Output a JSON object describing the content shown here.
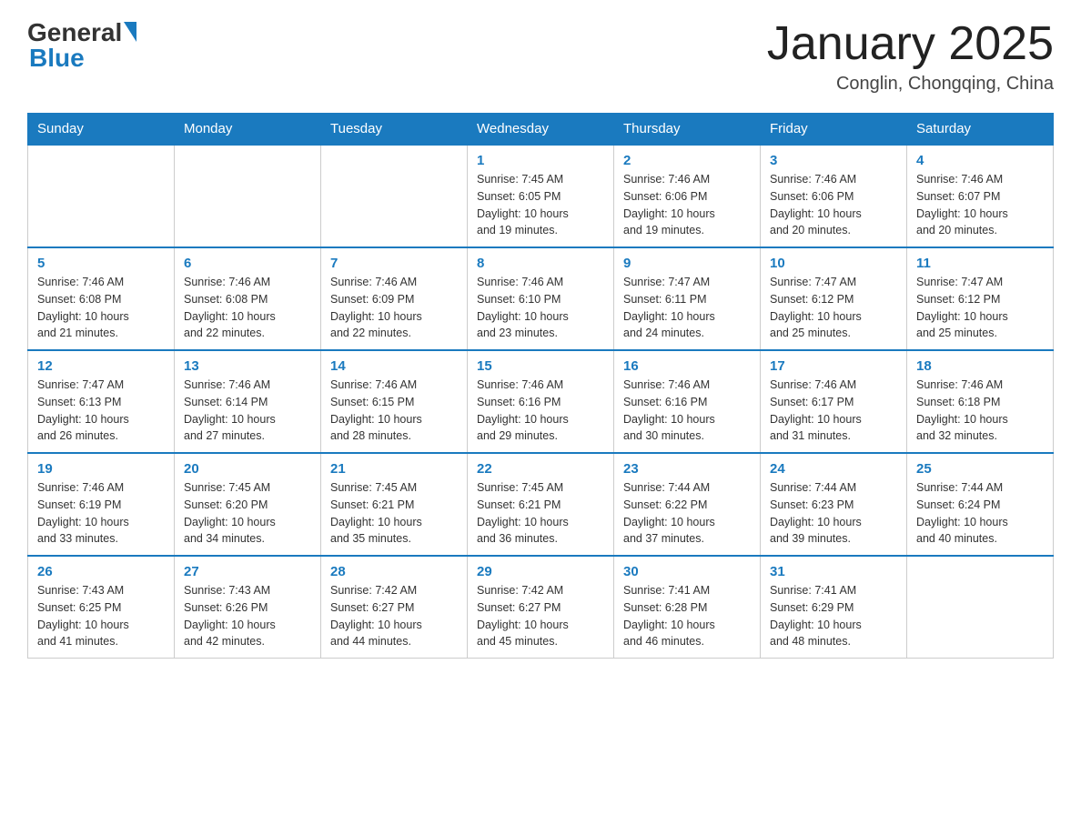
{
  "header": {
    "logo_general": "General",
    "logo_blue": "Blue",
    "month_title": "January 2025",
    "location": "Conglin, Chongqing, China"
  },
  "days_of_week": [
    "Sunday",
    "Monday",
    "Tuesday",
    "Wednesday",
    "Thursday",
    "Friday",
    "Saturday"
  ],
  "weeks": [
    [
      {
        "day": "",
        "info": ""
      },
      {
        "day": "",
        "info": ""
      },
      {
        "day": "",
        "info": ""
      },
      {
        "day": "1",
        "info": "Sunrise: 7:45 AM\nSunset: 6:05 PM\nDaylight: 10 hours\nand 19 minutes."
      },
      {
        "day": "2",
        "info": "Sunrise: 7:46 AM\nSunset: 6:06 PM\nDaylight: 10 hours\nand 19 minutes."
      },
      {
        "day": "3",
        "info": "Sunrise: 7:46 AM\nSunset: 6:06 PM\nDaylight: 10 hours\nand 20 minutes."
      },
      {
        "day": "4",
        "info": "Sunrise: 7:46 AM\nSunset: 6:07 PM\nDaylight: 10 hours\nand 20 minutes."
      }
    ],
    [
      {
        "day": "5",
        "info": "Sunrise: 7:46 AM\nSunset: 6:08 PM\nDaylight: 10 hours\nand 21 minutes."
      },
      {
        "day": "6",
        "info": "Sunrise: 7:46 AM\nSunset: 6:08 PM\nDaylight: 10 hours\nand 22 minutes."
      },
      {
        "day": "7",
        "info": "Sunrise: 7:46 AM\nSunset: 6:09 PM\nDaylight: 10 hours\nand 22 minutes."
      },
      {
        "day": "8",
        "info": "Sunrise: 7:46 AM\nSunset: 6:10 PM\nDaylight: 10 hours\nand 23 minutes."
      },
      {
        "day": "9",
        "info": "Sunrise: 7:47 AM\nSunset: 6:11 PM\nDaylight: 10 hours\nand 24 minutes."
      },
      {
        "day": "10",
        "info": "Sunrise: 7:47 AM\nSunset: 6:12 PM\nDaylight: 10 hours\nand 25 minutes."
      },
      {
        "day": "11",
        "info": "Sunrise: 7:47 AM\nSunset: 6:12 PM\nDaylight: 10 hours\nand 25 minutes."
      }
    ],
    [
      {
        "day": "12",
        "info": "Sunrise: 7:47 AM\nSunset: 6:13 PM\nDaylight: 10 hours\nand 26 minutes."
      },
      {
        "day": "13",
        "info": "Sunrise: 7:46 AM\nSunset: 6:14 PM\nDaylight: 10 hours\nand 27 minutes."
      },
      {
        "day": "14",
        "info": "Sunrise: 7:46 AM\nSunset: 6:15 PM\nDaylight: 10 hours\nand 28 minutes."
      },
      {
        "day": "15",
        "info": "Sunrise: 7:46 AM\nSunset: 6:16 PM\nDaylight: 10 hours\nand 29 minutes."
      },
      {
        "day": "16",
        "info": "Sunrise: 7:46 AM\nSunset: 6:16 PM\nDaylight: 10 hours\nand 30 minutes."
      },
      {
        "day": "17",
        "info": "Sunrise: 7:46 AM\nSunset: 6:17 PM\nDaylight: 10 hours\nand 31 minutes."
      },
      {
        "day": "18",
        "info": "Sunrise: 7:46 AM\nSunset: 6:18 PM\nDaylight: 10 hours\nand 32 minutes."
      }
    ],
    [
      {
        "day": "19",
        "info": "Sunrise: 7:46 AM\nSunset: 6:19 PM\nDaylight: 10 hours\nand 33 minutes."
      },
      {
        "day": "20",
        "info": "Sunrise: 7:45 AM\nSunset: 6:20 PM\nDaylight: 10 hours\nand 34 minutes."
      },
      {
        "day": "21",
        "info": "Sunrise: 7:45 AM\nSunset: 6:21 PM\nDaylight: 10 hours\nand 35 minutes."
      },
      {
        "day": "22",
        "info": "Sunrise: 7:45 AM\nSunset: 6:21 PM\nDaylight: 10 hours\nand 36 minutes."
      },
      {
        "day": "23",
        "info": "Sunrise: 7:44 AM\nSunset: 6:22 PM\nDaylight: 10 hours\nand 37 minutes."
      },
      {
        "day": "24",
        "info": "Sunrise: 7:44 AM\nSunset: 6:23 PM\nDaylight: 10 hours\nand 39 minutes."
      },
      {
        "day": "25",
        "info": "Sunrise: 7:44 AM\nSunset: 6:24 PM\nDaylight: 10 hours\nand 40 minutes."
      }
    ],
    [
      {
        "day": "26",
        "info": "Sunrise: 7:43 AM\nSunset: 6:25 PM\nDaylight: 10 hours\nand 41 minutes."
      },
      {
        "day": "27",
        "info": "Sunrise: 7:43 AM\nSunset: 6:26 PM\nDaylight: 10 hours\nand 42 minutes."
      },
      {
        "day": "28",
        "info": "Sunrise: 7:42 AM\nSunset: 6:27 PM\nDaylight: 10 hours\nand 44 minutes."
      },
      {
        "day": "29",
        "info": "Sunrise: 7:42 AM\nSunset: 6:27 PM\nDaylight: 10 hours\nand 45 minutes."
      },
      {
        "day": "30",
        "info": "Sunrise: 7:41 AM\nSunset: 6:28 PM\nDaylight: 10 hours\nand 46 minutes."
      },
      {
        "day": "31",
        "info": "Sunrise: 7:41 AM\nSunset: 6:29 PM\nDaylight: 10 hours\nand 48 minutes."
      },
      {
        "day": "",
        "info": ""
      }
    ]
  ]
}
